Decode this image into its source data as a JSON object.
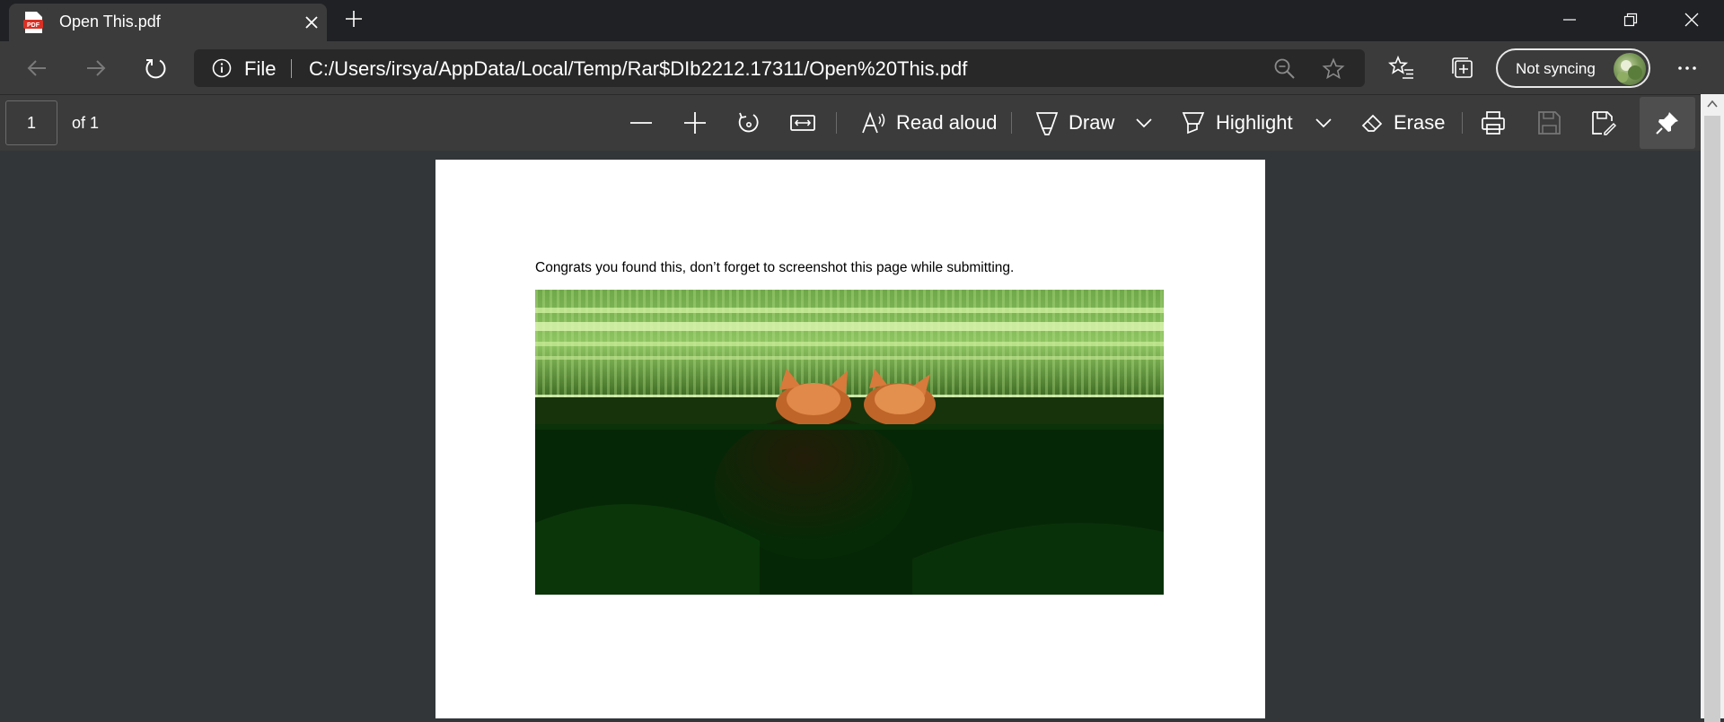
{
  "tab": {
    "title": "Open This.pdf",
    "icon": "pdf-icon",
    "pdf_badge": "PDF"
  },
  "window_controls": [
    "minimize-icon",
    "restore-icon",
    "close-icon"
  ],
  "address_bar": {
    "scheme_label": "File",
    "url": "C:/Users/irsya/AppData/Local/Temp/Rar$DIb2212.17311/Open%20This.pdf"
  },
  "profile": {
    "sync_label": "Not syncing"
  },
  "pdf_toolbar": {
    "page_number": "1",
    "page_total": "of 1",
    "read_aloud": "Read aloud",
    "draw": "Draw",
    "highlight": "Highlight",
    "erase": "Erase"
  },
  "document": {
    "text": "Congrats you found this, don’t forget to screenshot this page while submitting."
  },
  "colors": {
    "tabstrip": "#202124",
    "toolbar": "#3b3b3b",
    "viewer": "#323639",
    "page": "#ffffff"
  }
}
